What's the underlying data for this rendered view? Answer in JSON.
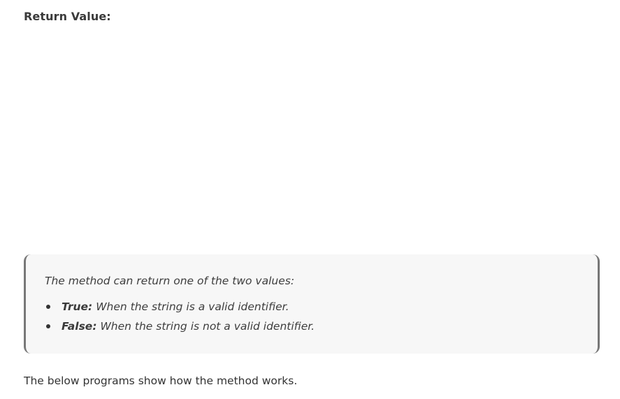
{
  "heading": "Return Value:",
  "callout": {
    "intro": "The method can return one of the two values:",
    "items": [
      {
        "term": "True:",
        "desc": "When the string is a valid identifier."
      },
      {
        "term": "False:",
        "desc": "When the string is not a valid identifier."
      }
    ]
  },
  "footer_text": "The below programs show how the method works."
}
